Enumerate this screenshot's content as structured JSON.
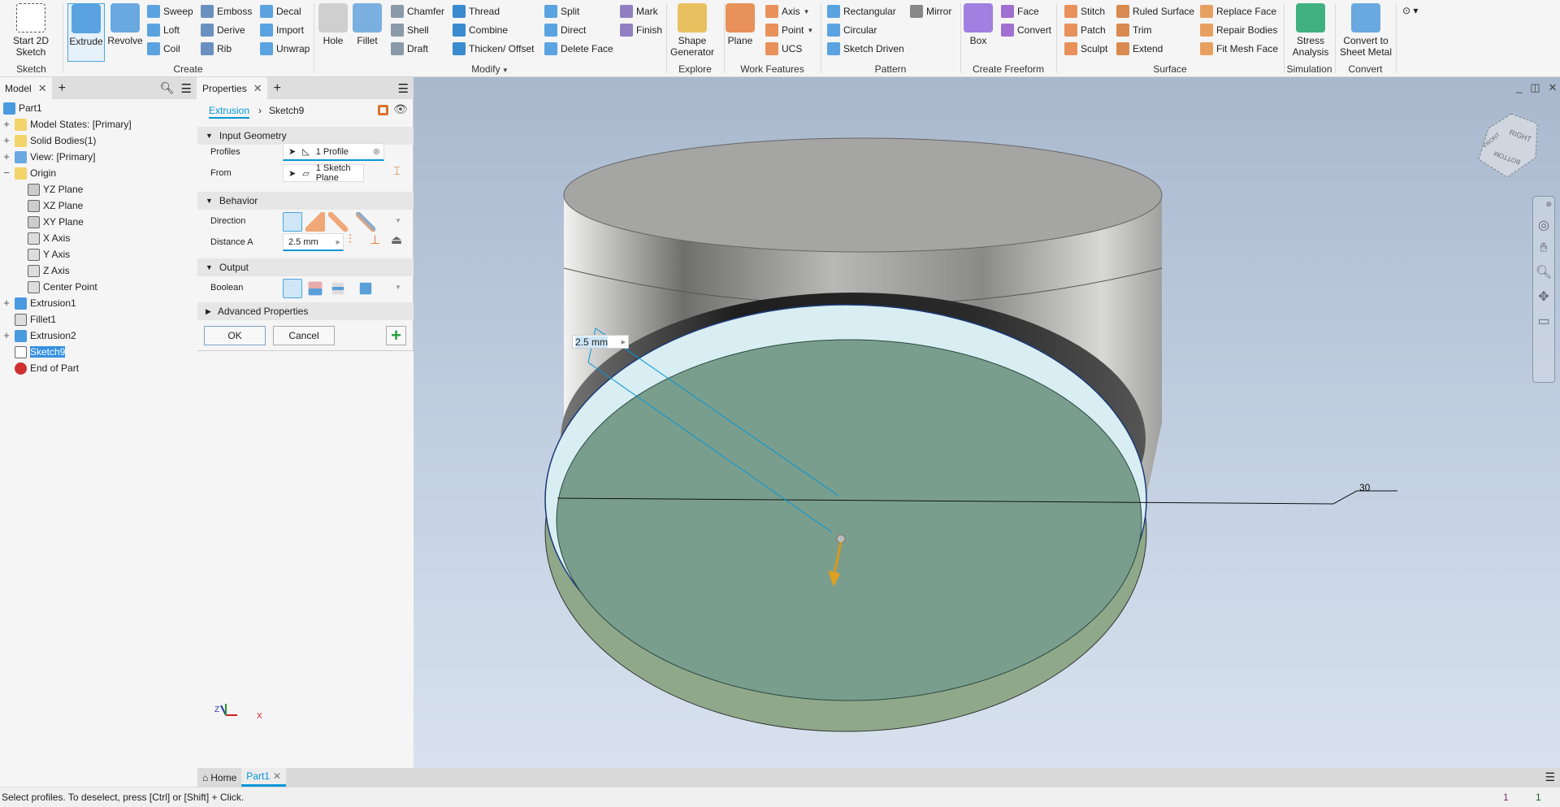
{
  "ribbon": {
    "groups": [
      "Sketch",
      "Create",
      "Modify",
      "Explore",
      "Work Features",
      "Pattern",
      "Create Freeform",
      "Surface",
      "Simulation",
      "Convert"
    ],
    "modify_caret": "▼",
    "start_2d_sketch": "Start 2D Sketch",
    "extrude": "Extrude",
    "revolve": "Revolve",
    "sweep": "Sweep",
    "loft": "Loft",
    "coil": "Coil",
    "emboss": "Emboss",
    "derive": "Derive",
    "rib": "Rib",
    "decal": "Decal",
    "import": "Import",
    "unwrap": "Unwrap",
    "hole": "Hole",
    "fillet": "Fillet",
    "chamfer": "Chamfer",
    "shell": "Shell",
    "draft": "Draft",
    "thread": "Thread",
    "combine": "Combine",
    "thicken_offset": "Thicken/ Offset",
    "split": "Split",
    "direct": "Direct",
    "delete_face": "Delete Face",
    "mark": "Mark",
    "finish": "Finish",
    "shape_generator": "Shape Generator",
    "plane": "Plane",
    "axis": "Axis",
    "point": "Point",
    "ucs": "UCS",
    "rectangular": "Rectangular",
    "circular": "Circular",
    "sketch_driven": "Sketch Driven",
    "mirror": "Mirror",
    "box": "Box",
    "face": "Face",
    "convert_ff": "Convert",
    "stitch": "Stitch",
    "patch": "Patch",
    "sculpt": "Sculpt",
    "ruled_surface": "Ruled Surface",
    "trim": "Trim",
    "extend": "Extend",
    "replace_face": "Replace Face",
    "repair_bodies": "Repair Bodies",
    "fit_mesh_face": "Fit Mesh Face",
    "stress_analysis": "Stress Analysis",
    "convert_sheet_metal": "Convert to Sheet Metal"
  },
  "browser": {
    "tab": "Model",
    "items": [
      {
        "label": "Part1"
      },
      {
        "label": "Model States: [Primary]"
      },
      {
        "label": "Solid Bodies(1)"
      },
      {
        "label": "View: [Primary]"
      },
      {
        "label": "Origin"
      },
      {
        "label": "YZ Plane"
      },
      {
        "label": "XZ Plane"
      },
      {
        "label": "XY Plane"
      },
      {
        "label": "X Axis"
      },
      {
        "label": "Y Axis"
      },
      {
        "label": "Z Axis"
      },
      {
        "label": "Center Point"
      },
      {
        "label": "Extrusion1"
      },
      {
        "label": "Fillet1"
      },
      {
        "label": "Extrusion2"
      },
      {
        "label": "Sketch9"
      },
      {
        "label": "End of Part"
      }
    ]
  },
  "properties": {
    "tab": "Properties",
    "breadcrumb_feature": "Extrusion",
    "breadcrumb_sketch": "Sketch9",
    "input_geometry": "Input Geometry",
    "profiles_label": "Profiles",
    "profiles_value": "1 Profile",
    "from_label": "From",
    "from_value": "1 Sketch Plane",
    "behavior": "Behavior",
    "direction_label": "Direction",
    "distance_label": "Distance A",
    "distance_value": "2.5 mm",
    "output": "Output",
    "boolean_label": "Boolean",
    "advanced": "Advanced Properties",
    "ok": "OK",
    "cancel": "Cancel"
  },
  "viewport": {
    "distance_input": "2.5 mm",
    "dimension_label": "30",
    "viewcube_faces": [
      "FRONT",
      "RIGHT",
      "BOTTOM"
    ],
    "colors": {
      "profile_fill": "#7a9e8e",
      "accent": "#0696d7",
      "arrow": "#e0a020"
    }
  },
  "doc_tabs": {
    "home": "Home",
    "part": "Part1"
  },
  "status": {
    "message": "Select profiles. To deselect, press [Ctrl] or [Shift] + Click.",
    "count1": "1",
    "count2": "1"
  }
}
